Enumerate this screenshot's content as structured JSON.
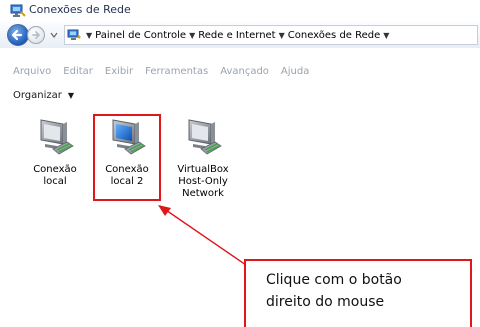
{
  "window": {
    "title": "Conexões de Rede"
  },
  "addressbar": {
    "breadcrumbs": [
      "Painel de Controle",
      "Rede e Internet",
      "Conexões de Rede"
    ]
  },
  "menu": {
    "items": [
      "Arquivo",
      "Editar",
      "Exibir",
      "Ferramentas",
      "Avançado",
      "Ajuda"
    ]
  },
  "toolbar": {
    "organize_label": "Organizar"
  },
  "connections": [
    {
      "label": "Conexão\nlocal",
      "selected": false
    },
    {
      "label": "Conexão\nlocal 2",
      "selected": true
    },
    {
      "label": "VirtualBox\nHost-Only\nNetwork",
      "selected": false
    }
  ],
  "callout": {
    "text": "Clique com o botão\ndireito do mouse"
  },
  "colors": {
    "highlight_red": "#e0161b",
    "menu_disabled": "#9aa3ae",
    "selected_monitor_screen": "#1f73d9"
  }
}
